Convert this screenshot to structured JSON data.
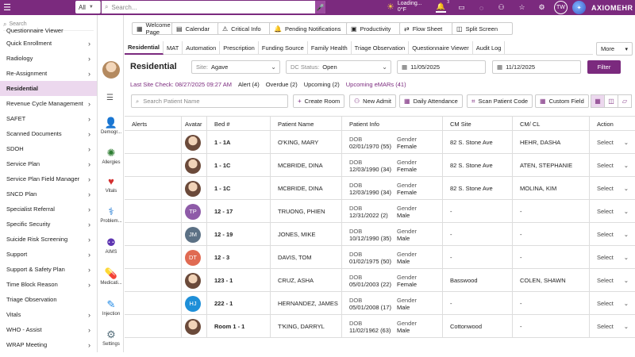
{
  "topbar": {
    "all_label": "All",
    "search_placeholder": "Search...",
    "weather": {
      "status": "Loading...",
      "temp": "0°F"
    },
    "notification_count": "3",
    "user_initials": "TW",
    "brand": "AXIOMEHR",
    "colors": {
      "bar": "#7b2a7e"
    }
  },
  "leftnav": {
    "search_placeholder": "Search",
    "items": [
      {
        "label": "Questionnaire Viewer",
        "chevron": false
      },
      {
        "label": "Quick Enrollment",
        "chevron": true
      },
      {
        "label": "Radiology",
        "chevron": true
      },
      {
        "label": "Re-Assignment",
        "chevron": true
      },
      {
        "label": "Residential",
        "chevron": false,
        "active": true
      },
      {
        "label": "Revenue Cycle Management",
        "chevron": true
      },
      {
        "label": "SAFET",
        "chevron": true
      },
      {
        "label": "Scanned Documents",
        "chevron": true
      },
      {
        "label": "SDOH",
        "chevron": true
      },
      {
        "label": "Service Plan",
        "chevron": true
      },
      {
        "label": "Service Plan Field Manager",
        "chevron": true
      },
      {
        "label": "SNCD Plan",
        "chevron": true
      },
      {
        "label": "Specialist Referral",
        "chevron": true
      },
      {
        "label": "Specific Security",
        "chevron": true
      },
      {
        "label": "Suicide Risk Screening",
        "chevron": true
      },
      {
        "label": "Support",
        "chevron": true
      },
      {
        "label": "Support & Safety Plan",
        "chevron": true
      },
      {
        "label": "Time Block Reason",
        "chevron": true
      },
      {
        "label": "Triage Observation",
        "chevron": false
      },
      {
        "label": "Vitals",
        "chevron": true
      },
      {
        "label": "WHO - Assist",
        "chevron": true
      },
      {
        "label": "WRAP Meeting",
        "chevron": true
      }
    ]
  },
  "rail": {
    "items": [
      {
        "label": "Demogr...",
        "icon": "person-icon"
      },
      {
        "label": "Allergies",
        "icon": "allergy-icon"
      },
      {
        "label": "Vitals",
        "icon": "heart-icon"
      },
      {
        "label": "Problem...",
        "icon": "problem-icon"
      },
      {
        "label": "AIMS",
        "icon": "aims-icon"
      },
      {
        "label": "Medicati...",
        "icon": "pill-icon"
      },
      {
        "label": "Injection",
        "icon": "syringe-icon"
      },
      {
        "label": "Settings",
        "icon": "gear-icon"
      }
    ]
  },
  "quicklinks": [
    {
      "label": "Welcome Page",
      "icon": "▦"
    },
    {
      "label": "Calendar",
      "icon": "▤"
    },
    {
      "label": "Critical Info",
      "icon": "⚠"
    },
    {
      "label": "Pending Notifications",
      "icon": "🔔"
    },
    {
      "label": "Productivity",
      "icon": "▣"
    },
    {
      "label": "Flow Sheet",
      "icon": "⇄"
    },
    {
      "label": "Split Screen",
      "icon": "◫"
    }
  ],
  "tabs": [
    "Residential",
    "MAT",
    "Automation",
    "Prescription",
    "Funding Source",
    "Family Health",
    "Triage Observation",
    "Questionnaire Viewer",
    "Audit Log"
  ],
  "more_label": "More",
  "page": {
    "title": "Residential",
    "site_label": "Site:",
    "site_value": "Agave",
    "dc_label": "DC Status:",
    "dc_value": "Open",
    "date_from": "11/05/2025",
    "date_to": "11/12/2025",
    "filter_label": "Filter"
  },
  "subnav": {
    "last_site_check": "Last Site Check: 08/27/2025 09:27 AM",
    "alert": "Alert (4)",
    "overdue": "Overdue (2)",
    "upcoming": "Upcoming (2)",
    "upcoming_emars": "Upcoming eMARs (41)"
  },
  "actions": {
    "search_placeholder": "Search Patient Name",
    "create_room": "Create Room",
    "new_admit": "New Admit",
    "daily_attendance": "Daily Attendance",
    "scan_patient_code": "Scan Patient Code",
    "custom_field": "Custom Field"
  },
  "table": {
    "headers": [
      "Alerts",
      "Avatar",
      "Bed #",
      "Patient Name",
      "Patient Info",
      "CM Site",
      "CM/ CL",
      "Action"
    ],
    "dob_label": "DOB",
    "gender_label": "Gender",
    "select_label": "Select",
    "rows": [
      {
        "avatar": "photo",
        "initials": "",
        "color": "",
        "bed": "1 - 1A",
        "name": "O'KING, MARY",
        "dob": "02/01/1970 (55)",
        "gender": "Female",
        "site": "82 S. Stone Ave",
        "cm": "HEHR, DASHA"
      },
      {
        "avatar": "photo",
        "initials": "",
        "color": "",
        "bed": "1 - 1C",
        "name": "MCBRIDE, DINA",
        "dob": "12/03/1990 (34)",
        "gender": "Female",
        "site": "82 S. Stone Ave",
        "cm": "ATEN, STEPHANIE"
      },
      {
        "avatar": "photo",
        "initials": "",
        "color": "",
        "bed": "1 - 1C",
        "name": "MCBRIDE, DINA",
        "dob": "12/03/1990 (34)",
        "gender": "Female",
        "site": "82 S. Stone Ave",
        "cm": "MOLINA, KIM"
      },
      {
        "avatar": "initials",
        "initials": "TP",
        "color": "#8e5ba8",
        "bed": "12 - 17",
        "name": "TRUONG, PHIEN",
        "dob": "12/31/2022 (2)",
        "gender": "Male",
        "site": "-",
        "cm": "-"
      },
      {
        "avatar": "initials",
        "initials": "JM",
        "color": "#5c7185",
        "bed": "12 - 19",
        "name": "JONES, MIKE",
        "dob": "10/12/1990 (35)",
        "gender": "Male",
        "site": "-",
        "cm": "-"
      },
      {
        "avatar": "initials",
        "initials": "DT",
        "color": "#e06a52",
        "bed": "12 - 3",
        "name": "DAVIS, TOM",
        "dob": "01/02/1975 (50)",
        "gender": "Male",
        "site": "-",
        "cm": "-"
      },
      {
        "avatar": "photo",
        "initials": "",
        "color": "",
        "bed": "123 - 1",
        "name": "CRUZ, ASHA",
        "dob": "05/01/2003 (22)",
        "gender": "Female",
        "site": "Basswood",
        "cm": "COLEN, SHAWN"
      },
      {
        "avatar": "initials",
        "initials": "HJ",
        "color": "#1e8fd8",
        "bed": "222 - 1",
        "name": "HERNANDEZ, JAMES",
        "dob": "05/01/2008 (17)",
        "gender": "Male",
        "site": "-",
        "cm": "-"
      },
      {
        "avatar": "photo",
        "initials": "",
        "color": "",
        "bed": "Room 1 - 1",
        "name": "T'KING, DARRYL",
        "dob": "11/02/1962 (63)",
        "gender": "Male",
        "site": "Cottonwood",
        "cm": "-"
      }
    ]
  }
}
